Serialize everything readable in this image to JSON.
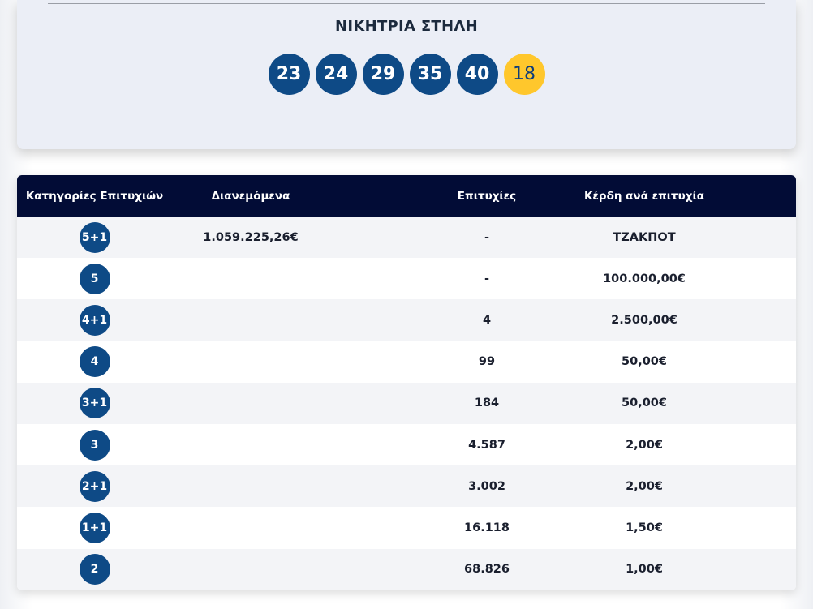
{
  "winning": {
    "title": "ΝΙΚΗΤΡΙΑ ΣΤΗΛΗ",
    "numbers": [
      "23",
      "24",
      "29",
      "35",
      "40"
    ],
    "joker": "18"
  },
  "table": {
    "headers": {
      "category": "Κατηγορίες Επιτυχιών",
      "distributed": "Διανεμόμενα",
      "winners": "Επιτυχίες",
      "prize": "Κέρδη ανά επιτυχία"
    },
    "rows": [
      {
        "category": "5+1",
        "distributed": "1.059.225,26€",
        "winners": "-",
        "prize": "ΤΖΑΚΠΟΤ"
      },
      {
        "category": "5",
        "distributed": "",
        "winners": "-",
        "prize": "100.000,00€"
      },
      {
        "category": "4+1",
        "distributed": "",
        "winners": "4",
        "prize": "2.500,00€"
      },
      {
        "category": "4",
        "distributed": "",
        "winners": "99",
        "prize": "50,00€"
      },
      {
        "category": "3+1",
        "distributed": "",
        "winners": "184",
        "prize": "50,00€"
      },
      {
        "category": "3",
        "distributed": "",
        "winners": "4.587",
        "prize": "2,00€"
      },
      {
        "category": "2+1",
        "distributed": "",
        "winners": "3.002",
        "prize": "2,00€"
      },
      {
        "category": "1+1",
        "distributed": "",
        "winners": "16.118",
        "prize": "1,50€"
      },
      {
        "category": "2",
        "distributed": "",
        "winners": "68.826",
        "prize": "1,00€"
      }
    ]
  },
  "colors": {
    "ball": "#0e4a86",
    "joker": "#ffc72c",
    "header": "#020c36"
  }
}
